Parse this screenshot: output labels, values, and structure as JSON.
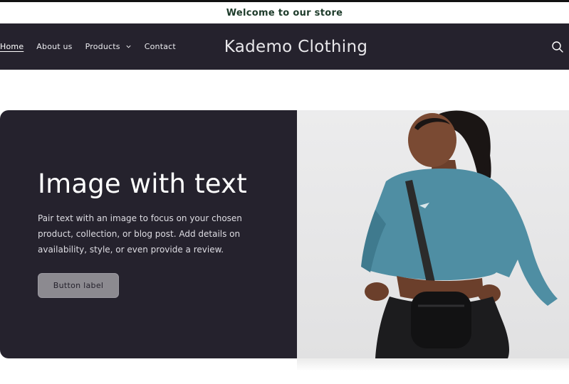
{
  "announcement": {
    "text": "Welcome to our store"
  },
  "header": {
    "nav": [
      {
        "label": "Home",
        "active": true
      },
      {
        "label": "About us",
        "active": false
      },
      {
        "label": "Products",
        "active": false,
        "has_dropdown": true
      },
      {
        "label": "Contact",
        "active": false
      }
    ],
    "brand": "Kademo Clothing",
    "search_icon": "search-icon"
  },
  "feature": {
    "heading": "Image with text",
    "body": "Pair text with an image to focus on your chosen product, collection, or blog post. Add details on availability, style, or even provide a review.",
    "button_label": "Button label",
    "image_alt": "model-photo"
  },
  "colors": {
    "header_bg": "#25222d",
    "announcement_text": "#1d3b2a",
    "button_bg": "#8c8a90",
    "image_bg": "#e6e6e7",
    "sweater": "#4f8ea3"
  }
}
